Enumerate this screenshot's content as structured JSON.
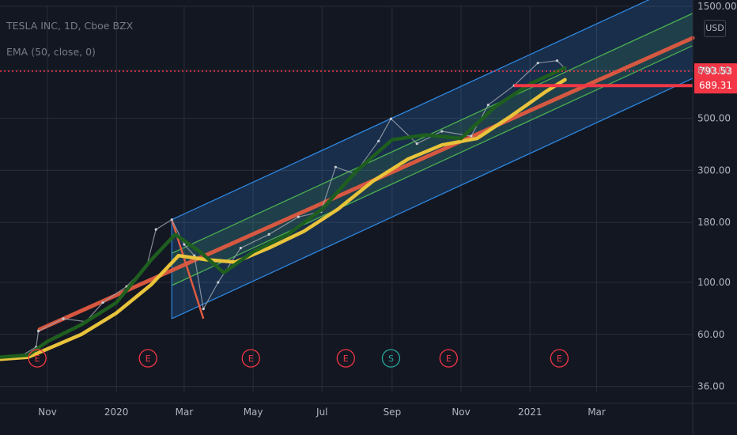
{
  "legend": {
    "title": "TESLA INC, 1D, Cboe BZX",
    "indicator": "EMA (50, close, 0)"
  },
  "axis": {
    "unit": "USD"
  },
  "colors": {
    "background": "#131722",
    "grid": "#2a2e39",
    "ema_fast": "#1e5e1e",
    "ema_slow": "#e8c33b",
    "regression": "#e05a40",
    "channel_outer": "#2e86de",
    "channel_inner": "#4caf50",
    "price_tag": "#f23645",
    "event_marker": "#f23645",
    "split_marker": "#26a69a"
  },
  "chart_data": {
    "type": "line",
    "title": "TESLA INC, 1D, Cboe BZX",
    "y_scale": "log",
    "ylim": [
      34,
      1500
    ],
    "x_range": [
      "2019-09-20",
      "2021-05-25"
    ],
    "grid": true,
    "y_ticks": [
      {
        "value": 1500,
        "label": "1500.00"
      },
      {
        "value": 800,
        "label": "800.00"
      },
      {
        "value": 500,
        "label": "500.00"
      },
      {
        "value": 300,
        "label": "300.00"
      },
      {
        "value": 180,
        "label": "180.00"
      },
      {
        "value": 100,
        "label": "100.00"
      },
      {
        "value": 60,
        "label": "60.00"
      },
      {
        "value": 36,
        "label": "36.00"
      }
    ],
    "x_ticks": [
      {
        "date": "2019-11-01",
        "label": "Nov"
      },
      {
        "date": "2020-01-01",
        "label": "2020"
      },
      {
        "date": "2020-03-01",
        "label": "Mar"
      },
      {
        "date": "2020-05-01",
        "label": "May"
      },
      {
        "date": "2020-07-01",
        "label": "Jul"
      },
      {
        "date": "2020-09-01",
        "label": "Sep"
      },
      {
        "date": "2020-11-01",
        "label": "Nov"
      },
      {
        "date": "2021-01-01",
        "label": "2021"
      },
      {
        "date": "2021-03-01",
        "label": "Mar"
      }
    ],
    "price_levels": [
      {
        "value": 793.53,
        "label": "793.53",
        "style": "dotted-line"
      },
      {
        "value": 689.31,
        "label": "689.31",
        "style": "segment"
      }
    ],
    "series": [
      {
        "name": "price",
        "points": [
          [
            "2019-09-20",
            48
          ],
          [
            "2019-10-10",
            49
          ],
          [
            "2019-10-22",
            53
          ],
          [
            "2019-10-24",
            62
          ],
          [
            "2019-11-15",
            70
          ],
          [
            "2019-12-05",
            68
          ],
          [
            "2019-12-20",
            82
          ],
          [
            "2020-01-10",
            96
          ],
          [
            "2020-01-28",
            118
          ],
          [
            "2020-02-05",
            168
          ],
          [
            "2020-02-19",
            185
          ],
          [
            "2020-03-01",
            145
          ],
          [
            "2020-03-10",
            130
          ],
          [
            "2020-03-18",
            77
          ],
          [
            "2020-03-31",
            100
          ],
          [
            "2020-04-20",
            140
          ],
          [
            "2020-05-15",
            160
          ],
          [
            "2020-06-10",
            190
          ],
          [
            "2020-06-30",
            200
          ],
          [
            "2020-07-13",
            310
          ],
          [
            "2020-07-30",
            290
          ],
          [
            "2020-08-20",
            400
          ],
          [
            "2020-08-31",
            498
          ],
          [
            "2020-09-23",
            390
          ],
          [
            "2020-10-15",
            440
          ],
          [
            "2020-11-10",
            420
          ],
          [
            "2020-11-25",
            570
          ],
          [
            "2020-12-18",
            690
          ],
          [
            "2021-01-08",
            860
          ],
          [
            "2021-01-25",
            880
          ],
          [
            "2021-02-01",
            815
          ]
        ]
      },
      {
        "name": "ema-slow",
        "points": [
          [
            "2019-09-20",
            47
          ],
          [
            "2019-10-15",
            48
          ],
          [
            "2019-11-01",
            52
          ],
          [
            "2019-12-01",
            60
          ],
          [
            "2020-01-01",
            74
          ],
          [
            "2020-02-01",
            98
          ],
          [
            "2020-02-25",
            130
          ],
          [
            "2020-03-20",
            125
          ],
          [
            "2020-04-15",
            122
          ],
          [
            "2020-05-15",
            140
          ],
          [
            "2020-06-15",
            165
          ],
          [
            "2020-07-15",
            205
          ],
          [
            "2020-08-15",
            270
          ],
          [
            "2020-09-15",
            335
          ],
          [
            "2020-10-15",
            385
          ],
          [
            "2020-11-15",
            410
          ],
          [
            "2020-12-15",
            510
          ],
          [
            "2021-01-15",
            650
          ],
          [
            "2021-02-01",
            730
          ]
        ]
      },
      {
        "name": "ema-fast",
        "points": [
          [
            "2019-09-20",
            48
          ],
          [
            "2019-10-15",
            49
          ],
          [
            "2019-11-01",
            56
          ],
          [
            "2019-12-01",
            66
          ],
          [
            "2020-01-01",
            82
          ],
          [
            "2020-02-01",
            125
          ],
          [
            "2020-02-22",
            160
          ],
          [
            "2020-03-15",
            135
          ],
          [
            "2020-04-05",
            110
          ],
          [
            "2020-05-01",
            135
          ],
          [
            "2020-06-01",
            160
          ],
          [
            "2020-07-01",
            205
          ],
          [
            "2020-08-01",
            300
          ],
          [
            "2020-09-01",
            405
          ],
          [
            "2020-10-01",
            425
          ],
          [
            "2020-11-01",
            410
          ],
          [
            "2020-12-01",
            560
          ],
          [
            "2021-01-01",
            700
          ],
          [
            "2021-02-01",
            820
          ]
        ]
      },
      {
        "name": "regression",
        "points": [
          [
            "2019-10-25",
            63
          ],
          [
            "2021-05-25",
            1100
          ]
        ]
      }
    ],
    "channel": {
      "start": "2020-02-19",
      "end": "2021-05-25",
      "outer_upper": [
        185,
        1950
      ],
      "inner_upper": [
        133,
        1400
      ],
      "inner_lower": [
        97,
        1020
      ],
      "outer_lower": [
        70,
        740
      ]
    },
    "annotation_line": {
      "points": [
        [
          "2020-02-19",
          185
        ],
        [
          "2020-03-18",
          70
        ]
      ]
    },
    "resistance_segment": {
      "start": "2020-12-18",
      "end": "2021-05-25",
      "value": 689.31
    },
    "events": [
      {
        "date": "2019-10-23",
        "label": "E",
        "kind": "earnings"
      },
      {
        "date": "2020-01-29",
        "label": "E",
        "kind": "earnings"
      },
      {
        "date": "2020-04-29",
        "label": "E",
        "kind": "earnings"
      },
      {
        "date": "2020-07-22",
        "label": "E",
        "kind": "earnings"
      },
      {
        "date": "2020-08-31",
        "label": "S",
        "kind": "split"
      },
      {
        "date": "2020-10-21",
        "label": "E",
        "kind": "earnings"
      },
      {
        "date": "2021-01-27",
        "label": "E",
        "kind": "earnings"
      }
    ]
  }
}
